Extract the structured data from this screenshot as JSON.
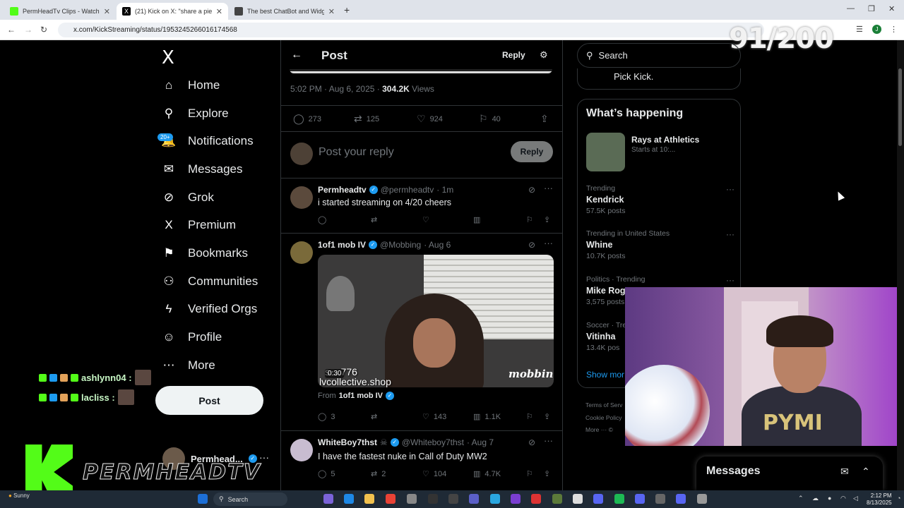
{
  "browser": {
    "tabs": [
      {
        "title": "PermHeadTv Clips - Watch Live",
        "color": "#53fc18",
        "active": false
      },
      {
        "title": "(21) Kick on X: \"share a piece of",
        "color": "#000000",
        "active": true
      },
      {
        "title": "The best ChatBot and Widgets",
        "color": "#444444",
        "active": false
      }
    ],
    "new_tab": "+",
    "url": "x.com/KickStreaming/status/1953245266016174568",
    "overlay_counter": "91/200",
    "profile_initial": "J"
  },
  "nav": {
    "logo": "X",
    "notif_badge": "20+",
    "items": [
      {
        "label": "Home",
        "icon": "home-icon",
        "glyph": "⌂"
      },
      {
        "label": "Explore",
        "icon": "search-icon",
        "glyph": "⚲"
      },
      {
        "label": "Notifications",
        "icon": "bell-icon",
        "glyph": "🔔"
      },
      {
        "label": "Messages",
        "icon": "envelope-icon",
        "glyph": "✉"
      },
      {
        "label": "Grok",
        "icon": "grok-icon",
        "glyph": "⊘"
      },
      {
        "label": "Premium",
        "icon": "x-premium-icon",
        "glyph": "X"
      },
      {
        "label": "Bookmarks",
        "icon": "bookmark-icon",
        "glyph": "⚑"
      },
      {
        "label": "Communities",
        "icon": "communities-icon",
        "glyph": "⚇"
      },
      {
        "label": "Verified Orgs",
        "icon": "lightning-icon",
        "glyph": "ϟ"
      },
      {
        "label": "Profile",
        "icon": "person-icon",
        "glyph": "☺"
      },
      {
        "label": "More",
        "icon": "more-circle-icon",
        "glyph": "⋯"
      }
    ],
    "post_label": "Post",
    "account_name": "Permhead..."
  },
  "chat_overlay": [
    {
      "user": "ashlynn04 :"
    },
    {
      "user": "lacliss :"
    }
  ],
  "stream_brand": "PERMHEADTV",
  "post_header": {
    "title": "Post",
    "reply_label": "Reply"
  },
  "post_meta": {
    "time": "5:02 PM · Aug 6, 2025 ·",
    "views": "304.2K",
    "views_label": "Views"
  },
  "post_actions": {
    "replies": "273",
    "reposts": "125",
    "likes": "924",
    "bookmarks": "40"
  },
  "reply_box": {
    "placeholder": "Post your reply",
    "button": "Reply"
  },
  "replies": [
    {
      "name": "Permheadtv",
      "handle": "@permheadtv",
      "time": "· 1m",
      "text": "i started streaming on 4/20 cheers",
      "replies": "",
      "reposts": "",
      "likes": "",
      "views": ""
    },
    {
      "name": "1of1 mob IV",
      "handle": "@Mobbing",
      "time": "· Aug 6",
      "video": {
        "duration": "0:30",
        "overlay_1": "s ...776",
        "overlay_2": "lvcollective.shop",
        "logo": "mobbing"
      },
      "from_label": "From",
      "from_name": "1of1 mob IV",
      "replies": "3",
      "reposts": "",
      "likes": "143",
      "views": "1.1K"
    },
    {
      "name": "WhiteBoy7thst",
      "handle": "@Whiteboy7thst",
      "time": "· Aug 7",
      "text": "I have the fastest nuke in Call of Duty MW2",
      "replies": "5",
      "reposts": "2",
      "likes": "104",
      "views": "4.7K"
    }
  ],
  "sidebar": {
    "search_placeholder": "Search",
    "pick_text": "Pick Kick.",
    "happening_title": "What’s happening",
    "event": {
      "title": "Rays at Athletics",
      "sub": "Starts at 10:..."
    },
    "trends": [
      {
        "context": "Trending",
        "title": "Kendrick",
        "count": "57.5K posts"
      },
      {
        "context": "Trending in United States",
        "title": "Whine",
        "count": "10.7K posts"
      },
      {
        "context": "Politics · Trending",
        "title": "Mike Rog",
        "count": "3,575 posts"
      },
      {
        "context": "Soccer · Tre",
        "title": "Vitinha",
        "count": "13.4K pos"
      }
    ],
    "show_more": "Show mor",
    "footer": [
      "Terms of Serv",
      "Cookie Policy",
      "More ··· ©"
    ]
  },
  "webcam": {
    "shirt_text": "PYMI"
  },
  "messages_drawer": {
    "title": "Messages"
  },
  "taskbar": {
    "weather": "Sunny",
    "search": "Search",
    "time": "2:12 PM",
    "date": "8/13/2025"
  }
}
